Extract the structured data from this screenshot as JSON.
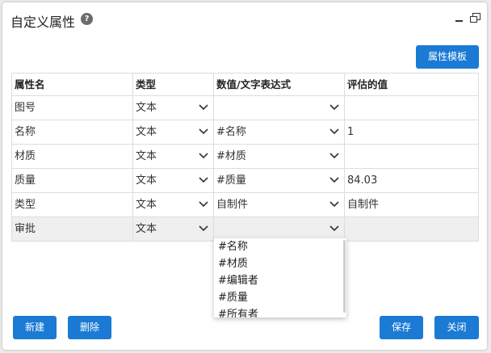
{
  "window": {
    "title": "自定义属性",
    "help_icon": "?"
  },
  "toolbar": {
    "template_label": "属性模板"
  },
  "table": {
    "headers": [
      "属性名",
      "类型",
      "数值/文字表达式",
      "评估的值"
    ],
    "rows": [
      {
        "name": "图号",
        "type": "文本",
        "expr": "",
        "value": ""
      },
      {
        "name": "名称",
        "type": "文本",
        "expr": "#名称",
        "value": "1"
      },
      {
        "name": "材质",
        "type": "文本",
        "expr": "#材质",
        "value": ""
      },
      {
        "name": "质量",
        "type": "文本",
        "expr": "#质量",
        "value": "84.03"
      },
      {
        "name": "类型",
        "type": "文本",
        "expr": "自制件",
        "value": "自制件"
      },
      {
        "name": "审批",
        "type": "文本",
        "expr": "",
        "value": ""
      }
    ]
  },
  "dropdown": {
    "options": [
      "#名称",
      "#材质",
      "#编辑者",
      "#质量",
      "#所有者"
    ]
  },
  "footer": {
    "new_label": "新建",
    "delete_label": "删除",
    "save_label": "保存",
    "close_label": "关闭"
  }
}
